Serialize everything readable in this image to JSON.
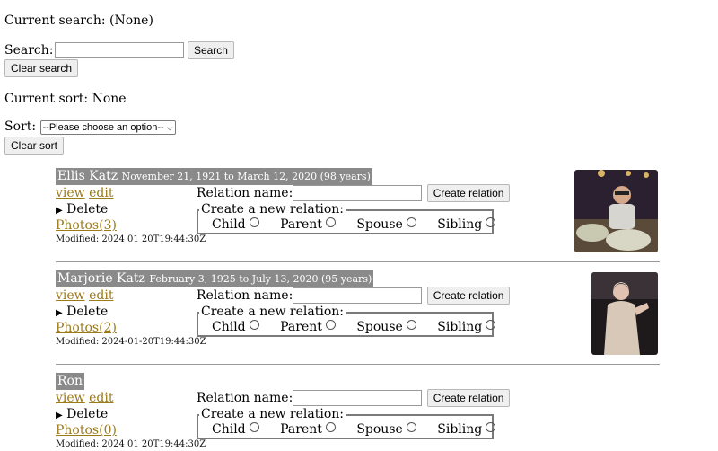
{
  "search": {
    "current_label": "Current search: (None)",
    "label": "Search:",
    "placeholder": "",
    "button": "Search",
    "clear": "Clear search"
  },
  "sort": {
    "current_label": "Current sort: None",
    "label": "Sort:",
    "selected": "--Please choose an option--",
    "clear": "Clear sort"
  },
  "relation_form": {
    "name_label": "Relation name:",
    "create_button": "Create relation",
    "legend": "Create a new relation:",
    "options": [
      "Child",
      "Parent",
      "Spouse",
      "Sibling"
    ]
  },
  "people": [
    {
      "name": "Ellis Katz",
      "dates": "November 21, 1921 to March 12, 2020 (98 years)",
      "view": "view",
      "edit": "edit",
      "delete": "Delete",
      "photos": "Photos(3)",
      "modified": "Modified: 2024 01 20T19:44:30Z"
    },
    {
      "name": "Marjorie Katz",
      "dates": "February 3, 1925 to July 13, 2020 (95 years)",
      "view": "view",
      "edit": "edit",
      "delete": "Delete",
      "photos": "Photos(2)",
      "modified": "Modified: 2024-01-20T19:44:30Z"
    },
    {
      "name": "Ron",
      "dates": "",
      "view": "view",
      "edit": "edit",
      "delete": "Delete",
      "photos": "Photos(0)",
      "modified": "Modified: 2024 01 20T19:44:30Z"
    }
  ]
}
